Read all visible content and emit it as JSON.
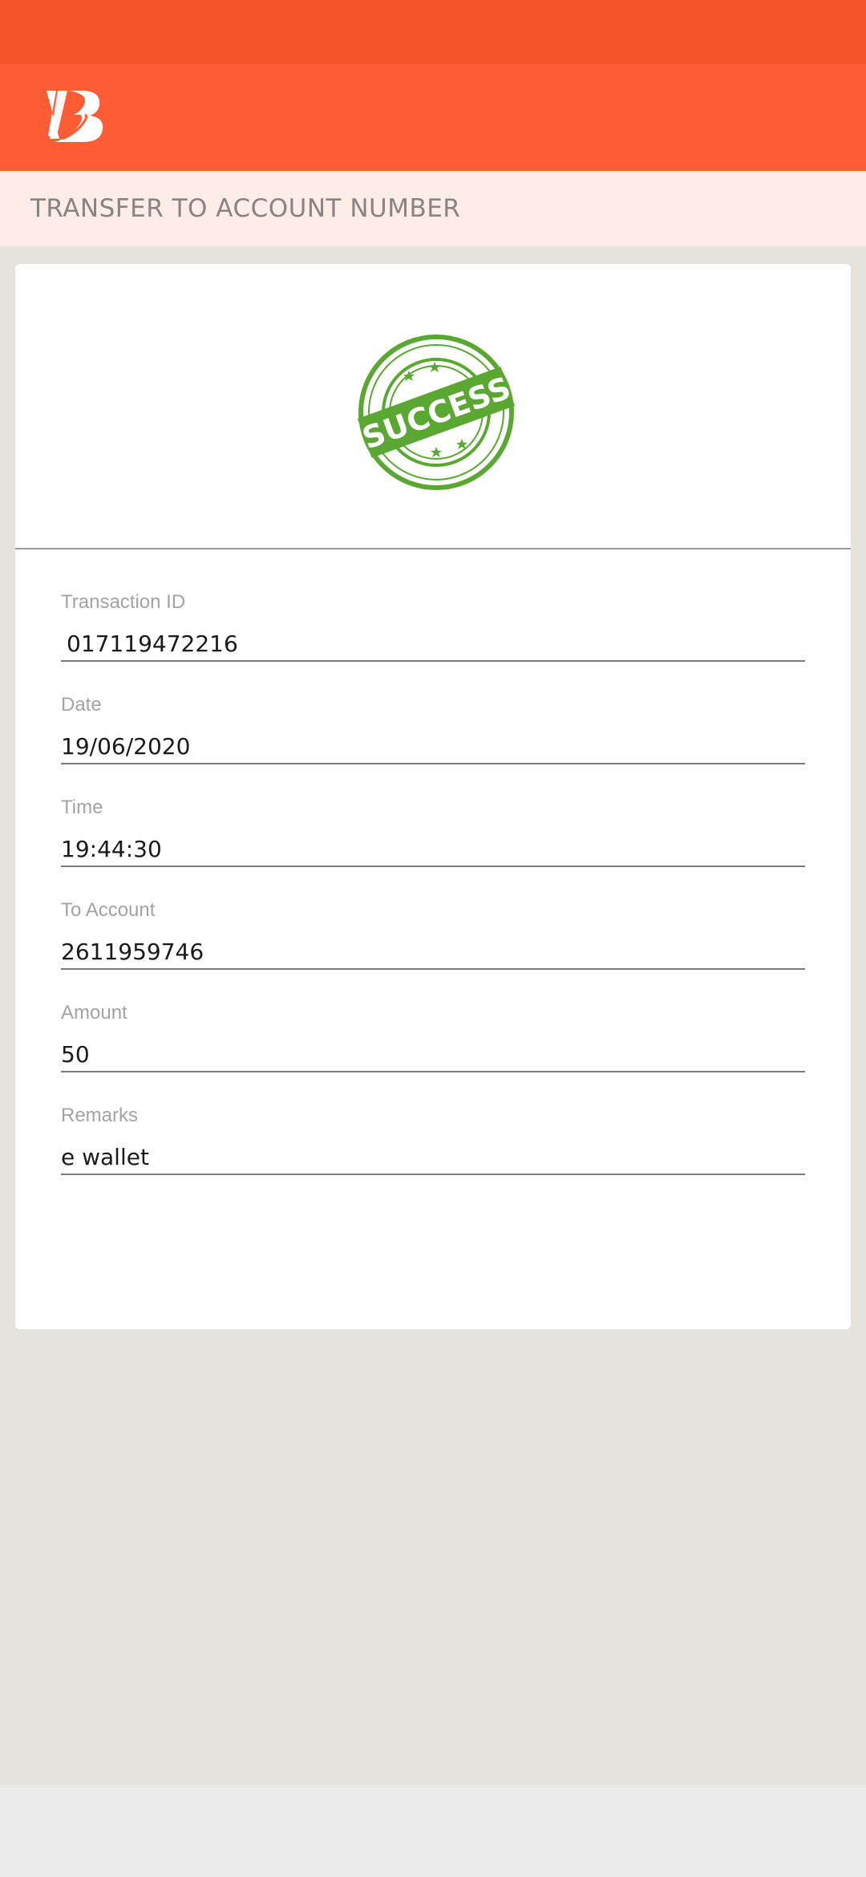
{
  "header": {
    "title": "TRANSFER TO ACCOUNT NUMBER",
    "logo_icon": "bank-of-baroda-logo-icon",
    "brand_color": "#fd5c35"
  },
  "status": {
    "stamp_text": "SUCCESS",
    "stamp_color": "#5aa832"
  },
  "fields": [
    {
      "label": "Transaction ID",
      "value": "017119472216"
    },
    {
      "label": "Date",
      "value": "19/06/2020"
    },
    {
      "label": "Time",
      "value": "19:44:30"
    },
    {
      "label": "To Account",
      "value": "2611959746"
    },
    {
      "label": "Amount",
      "value": "50"
    },
    {
      "label": "Remarks",
      "value": "e wallet"
    }
  ]
}
